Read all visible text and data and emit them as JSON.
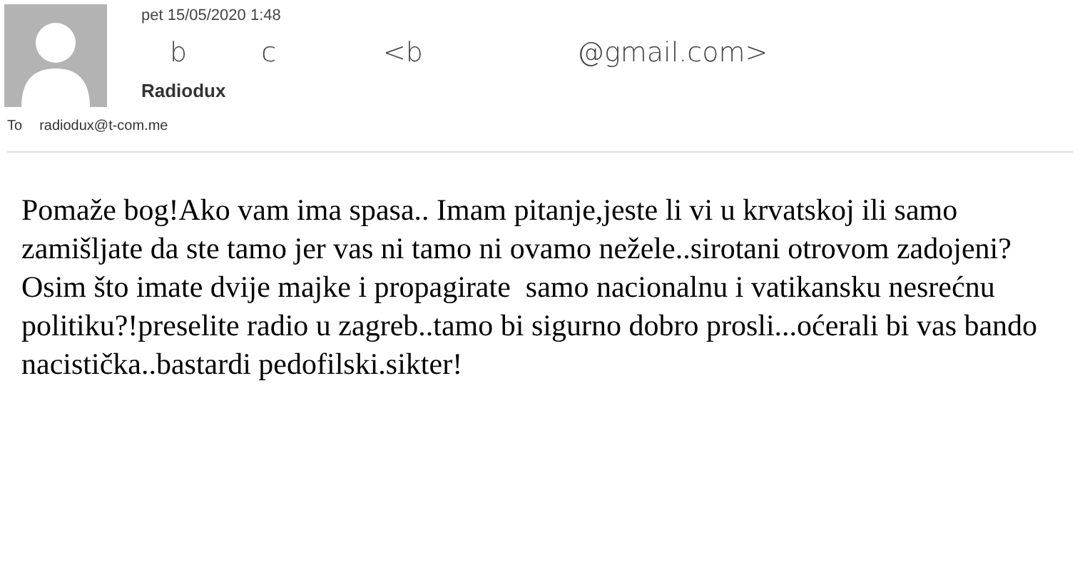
{
  "header": {
    "date": "pet 15/05/2020 1:48",
    "sender_parts": [
      "b",
      "c",
      "<b",
      "@gmail.com>"
    ],
    "subject": "Radiodux",
    "to_label": "To",
    "to": "radiodux@t-com.me"
  },
  "body": "Pomaže bog!Ako vam ima spasa.. Imam pitanje,jeste li vi u krvatskoj ili samo zamišljate da ste tamo jer vas ni tamo ni ovamo nežele..sirotani otrovom zadojeni? Osim što imate dvije majke i propagirate  samo nacionalnu i vatikansku nesrećnu politiku?!preselite radio u zagreb..tamo bi sigurno dobro prosli...oćerali bi vas bando nacistička..bastardi pedofilski.sikter!"
}
